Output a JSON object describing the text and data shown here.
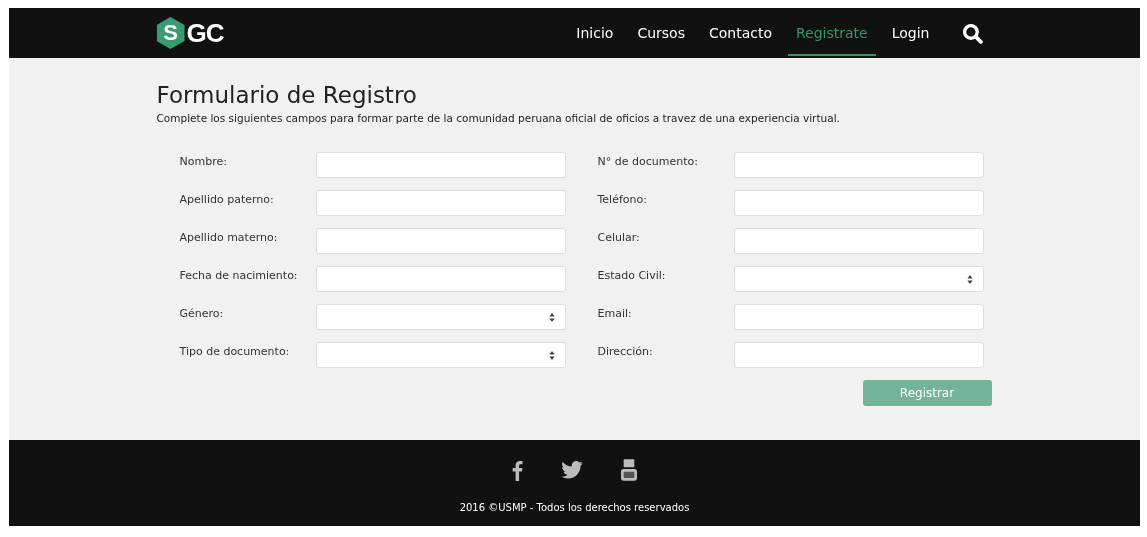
{
  "logo": {
    "mark": "S",
    "text": "GC"
  },
  "nav": [
    {
      "label": "Inicio",
      "selected": false
    },
    {
      "label": "Cursos",
      "selected": false
    },
    {
      "label": "Contacto",
      "selected": false
    },
    {
      "label": "Registrate",
      "selected": true
    },
    {
      "label": "Login",
      "selected": false
    }
  ],
  "form": {
    "title": "Formulario de Registro",
    "subtitle": "Complete los siguientes campos para formar parte de la comunidad peruana oficial de oficios a travez de una experiencia virtual.",
    "columns": [
      [
        {
          "label": "Nombre:",
          "kind": "text"
        },
        {
          "label": "Apellido paterno:",
          "kind": "text"
        },
        {
          "label": "Apellido materno:",
          "kind": "text"
        },
        {
          "label": "Fecha de nacimiento:",
          "kind": "text"
        },
        {
          "label": "Género:",
          "kind": "select"
        },
        {
          "label": "Tipo de documento:",
          "kind": "select"
        }
      ],
      [
        {
          "label": "N° de documento:",
          "kind": "text"
        },
        {
          "label": "Teléfono:",
          "kind": "text"
        },
        {
          "label": "Celular:",
          "kind": "text"
        },
        {
          "label": "Estado Civil:",
          "kind": "select"
        },
        {
          "label": "Email:",
          "kind": "text"
        },
        {
          "label": "Dirección:",
          "kind": "text"
        }
      ]
    ],
    "submit": "Registrar"
  },
  "footer": {
    "copyright": "2016 ©USMP - Todos los derechos reservados"
  }
}
